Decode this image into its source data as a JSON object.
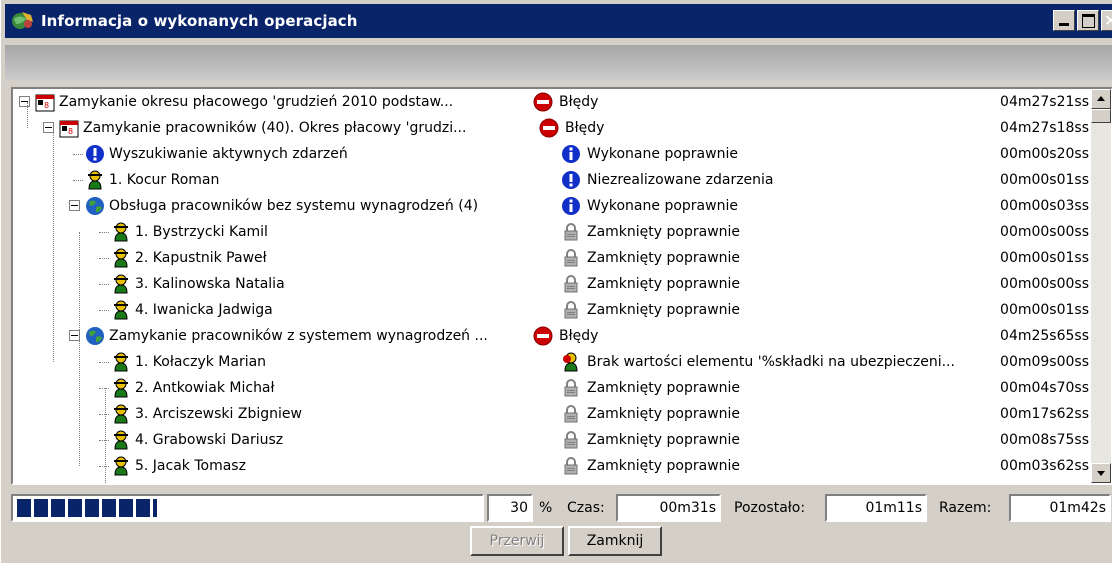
{
  "window": {
    "title": "Informacja o wykonanych operacjach"
  },
  "tree": {
    "rows": [
      {
        "label": "Zamykanie okresu płacowego 'grudzień 2010 podstaw...",
        "status": "Błędy",
        "status_icon": "error-icon",
        "node_icon": "calendar-icon",
        "duration": "04m27s21ss"
      },
      {
        "label": "Zamykanie pracowników (40). Okres płacowy 'grudzi...",
        "status": "Błędy",
        "status_icon": "error-icon",
        "node_icon": "calendar-icon",
        "duration": "04m27s18ss"
      },
      {
        "label": "Wyszukiwanie aktywnych zdarzeń",
        "status": "Wykonane poprawnie",
        "status_icon": "info-icon",
        "node_icon": "exclamation-icon",
        "duration": "00m00s20ss"
      },
      {
        "label": "1. Kocur Roman",
        "status": "Niezrealizowane zdarzenia",
        "status_icon": "exclamation-icon",
        "node_icon": "person-icon",
        "duration": "00m00s01ss"
      },
      {
        "label": "Obsługa pracowników bez systemu wynagrodzeń (4)",
        "status": "Wykonane poprawnie",
        "status_icon": "info-icon",
        "node_icon": "globe-icon",
        "duration": "00m00s03ss"
      },
      {
        "label": "1. Bystrzycki Kamil",
        "status": "Zamknięty poprawnie",
        "status_icon": "lock-icon",
        "node_icon": "person-icon",
        "duration": "00m00s00ss"
      },
      {
        "label": "2. Kapustnik Paweł",
        "status": "Zamknięty poprawnie",
        "status_icon": "lock-icon",
        "node_icon": "person-icon",
        "duration": "00m00s01ss"
      },
      {
        "label": "3. Kalinowska Natalia",
        "status": "Zamknięty poprawnie",
        "status_icon": "lock-icon",
        "node_icon": "person-icon",
        "duration": "00m00s00ss"
      },
      {
        "label": "4. Iwanicka Jadwiga",
        "status": "Zamknięty poprawnie",
        "status_icon": "lock-icon",
        "node_icon": "person-icon",
        "duration": "00m00s01ss"
      },
      {
        "label": "Zamykanie pracowników z systemem wynagrodzeń ...",
        "status": "Błędy",
        "status_icon": "error-icon",
        "node_icon": "globe-icon",
        "duration": "04m25s65ss"
      },
      {
        "label": "1. Kołaczyk Marian",
        "status": "Brak wartości elementu '%składki na ubezpieczeni...",
        "status_icon": "person-warning-icon",
        "node_icon": "person-icon",
        "duration": "00m09s00ss"
      },
      {
        "label": "2. Antkowiak Michał",
        "status": "Zamknięty poprawnie",
        "status_icon": "lock-icon",
        "node_icon": "person-icon",
        "duration": "00m04s70ss"
      },
      {
        "label": "3. Arciszewski Zbigniew",
        "status": "Zamknięty poprawnie",
        "status_icon": "lock-icon",
        "node_icon": "person-icon",
        "duration": "00m17s62ss"
      },
      {
        "label": "4. Grabowski Dariusz",
        "status": "Zamknięty poprawnie",
        "status_icon": "lock-icon",
        "node_icon": "person-icon",
        "duration": "00m08s75ss"
      },
      {
        "label": "5. Jacak Tomasz",
        "status": "Zamknięty poprawnie",
        "status_icon": "lock-icon",
        "node_icon": "person-icon",
        "duration": "00m03s62ss"
      }
    ]
  },
  "progress": {
    "percent": "30",
    "percent_sign": "%",
    "time_label": "Czas:",
    "time_value": "00m31s",
    "remaining_label": "Pozostało:",
    "remaining_value": "01m11s",
    "total_label": "Razem:",
    "total_value": "01m42s"
  },
  "buttons": {
    "interrupt": "Przerwij",
    "close": "Zamknij"
  },
  "colors": {
    "titlebar": "#0a246a",
    "progress_fill": "#0a246a",
    "error": "#cc0000",
    "info": "#1030c8"
  }
}
